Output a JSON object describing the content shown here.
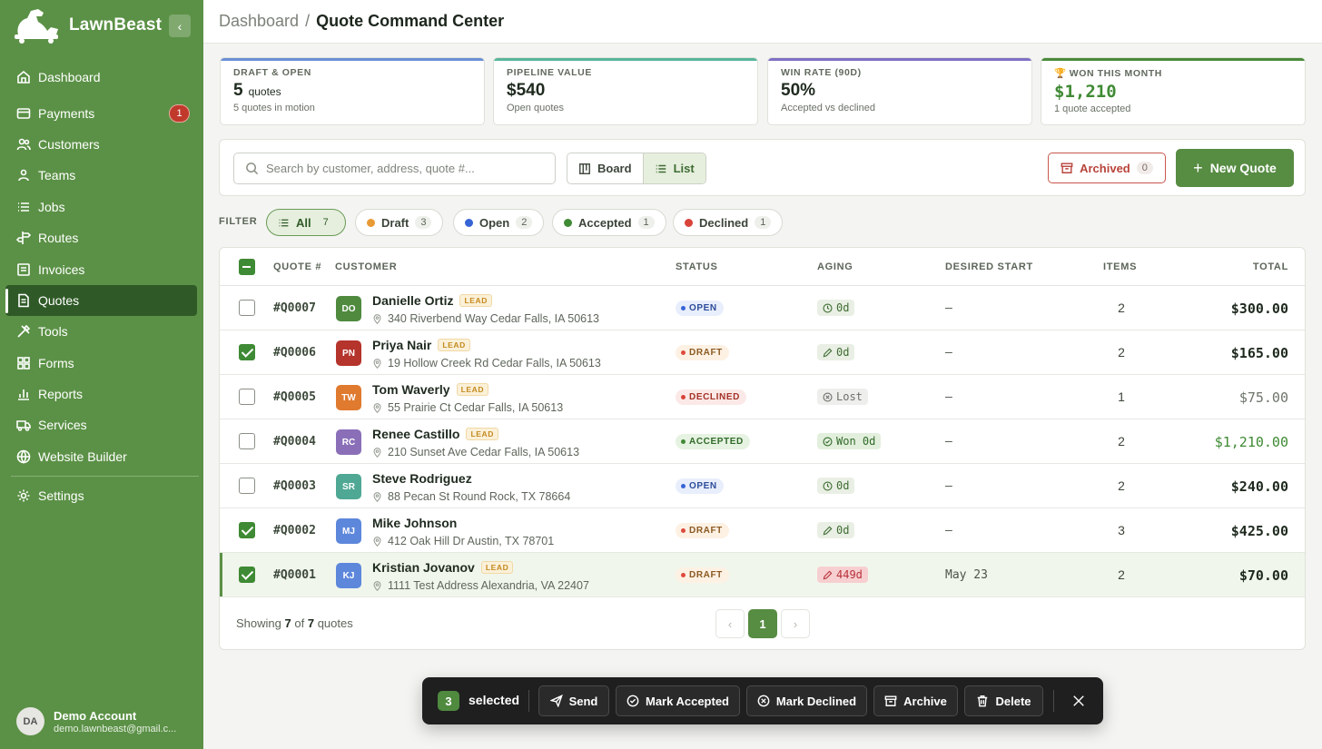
{
  "brand": {
    "name": "LawnBeast",
    "accent": "#5b9146"
  },
  "sidebar": {
    "items": [
      {
        "label": "Dashboard",
        "icon": "home-icon"
      },
      {
        "label": "Payments",
        "icon": "card-icon",
        "badge": "1"
      },
      {
        "label": "Customers",
        "icon": "users-icon"
      },
      {
        "label": "Teams",
        "icon": "team-icon"
      },
      {
        "label": "Jobs",
        "icon": "list-icon"
      },
      {
        "label": "Routes",
        "icon": "signpost-icon"
      },
      {
        "label": "Invoices",
        "icon": "invoice-icon"
      },
      {
        "label": "Quotes",
        "icon": "document-icon",
        "active": true
      },
      {
        "label": "Tools",
        "icon": "tools-icon"
      },
      {
        "label": "Forms",
        "icon": "grid-icon"
      },
      {
        "label": "Reports",
        "icon": "bar-chart-icon"
      },
      {
        "label": "Services",
        "icon": "truck-icon"
      },
      {
        "label": "Website Builder",
        "icon": "globe-icon"
      }
    ],
    "settings": {
      "label": "Settings",
      "icon": "gear-icon"
    },
    "account": {
      "initials": "DA",
      "name": "Demo Account",
      "email": "demo.lawnbeast@gmail.c..."
    }
  },
  "breadcrumb": {
    "parent": "Dashboard",
    "separator": "/",
    "current": "Quote Command Center"
  },
  "stats": [
    {
      "label": "DRAFT & OPEN",
      "value": "5",
      "unit": "quotes",
      "sub": "5 quotes in motion"
    },
    {
      "label": "PIPELINE VALUE",
      "value": "$540",
      "sub": "Open quotes"
    },
    {
      "label": "WIN RATE (90D)",
      "value": "50%",
      "sub": "Accepted vs declined"
    },
    {
      "label": "WON THIS MONTH",
      "value": "$1,210",
      "sub": "1 quote accepted"
    }
  ],
  "toolbar": {
    "search_placeholder": "Search by customer, address, quote #...",
    "view_board": "Board",
    "view_list": "List",
    "archived_label": "Archived",
    "archived_count": "0",
    "new_quote": "New Quote"
  },
  "filters": {
    "label": "FILTER",
    "chips": [
      {
        "label": "All",
        "count": "7",
        "active": true
      },
      {
        "label": "Draft",
        "count": "3",
        "color": "#e89a35"
      },
      {
        "label": "Open",
        "count": "2",
        "color": "#3765d6"
      },
      {
        "label": "Accepted",
        "count": "1",
        "color": "#3f8a34"
      },
      {
        "label": "Declined",
        "count": "1",
        "color": "#d8433a"
      }
    ]
  },
  "table": {
    "columns": [
      "QUOTE #",
      "CUSTOMER",
      "STATUS",
      "AGING",
      "DESIRED START",
      "ITEMS",
      "TOTAL"
    ],
    "rows": [
      {
        "checked": false,
        "quote": "#Q0007",
        "initials": "DO",
        "avatar_color": "#4f8a3f",
        "name": "Danielle Ortiz",
        "lead": "LEAD",
        "address": "340 Riverbend Way Cedar Falls, IA 50613",
        "status": "OPEN",
        "aging": "0d",
        "start": "—",
        "items": "2",
        "total": "$300.00"
      },
      {
        "checked": true,
        "quote": "#Q0006",
        "initials": "PN",
        "avatar_color": "#b5342c",
        "name": "Priya Nair",
        "lead": "LEAD",
        "address": "19 Hollow Creek Rd Cedar Falls, IA 50613",
        "status": "DRAFT",
        "aging": "0d",
        "start": "—",
        "items": "2",
        "total": "$165.00"
      },
      {
        "checked": false,
        "quote": "#Q0005",
        "initials": "TW",
        "avatar_color": "#e07a2f",
        "name": "Tom Waverly",
        "lead": "LEAD",
        "address": "55 Prairie Ct Cedar Falls, IA 50613",
        "status": "DECLINED",
        "aging": "Lost",
        "start": "—",
        "items": "1",
        "total": "$75.00"
      },
      {
        "checked": false,
        "quote": "#Q0004",
        "initials": "RC",
        "avatar_color": "#8a6fb8",
        "name": "Renee Castillo",
        "lead": "LEAD",
        "address": "210 Sunset Ave Cedar Falls, IA 50613",
        "status": "ACCEPTED",
        "aging": "Won 0d",
        "start": "—",
        "items": "2",
        "total": "$1,210.00"
      },
      {
        "checked": false,
        "quote": "#Q0003",
        "initials": "SR",
        "avatar_color": "#4fa894",
        "name": "Steve Rodriguez",
        "lead": "",
        "address": "88 Pecan St Round Rock, TX 78664",
        "status": "OPEN",
        "aging": "0d",
        "start": "—",
        "items": "2",
        "total": "$240.00"
      },
      {
        "checked": true,
        "quote": "#Q0002",
        "initials": "MJ",
        "avatar_color": "#5d87db",
        "name": "Mike Johnson",
        "lead": "",
        "address": "412 Oak Hill Dr Austin, TX 78701",
        "status": "DRAFT",
        "aging": "0d",
        "start": "—",
        "items": "3",
        "total": "$425.00"
      },
      {
        "checked": true,
        "quote": "#Q0001",
        "initials": "KJ",
        "avatar_color": "#5d87db",
        "name": "Kristian Jovanov",
        "lead": "LEAD",
        "address": "1111 Test Address Alexandria, VA 22407",
        "status": "DRAFT",
        "aging": "449d",
        "start": "May 23",
        "items": "2",
        "total": "$70.00"
      }
    ],
    "footer": {
      "showing": "Showing",
      "shown": "7",
      "of": "of",
      "total": "7",
      "suffix": "quotes"
    },
    "page": "1"
  },
  "bulk": {
    "count": "3",
    "selected_label": "selected",
    "actions": [
      "Send",
      "Mark Accepted",
      "Mark Declined",
      "Archive",
      "Delete"
    ]
  }
}
